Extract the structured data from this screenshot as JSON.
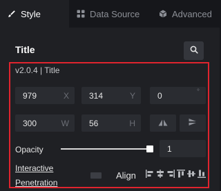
{
  "tabs": [
    {
      "label": "Style",
      "icon": "brush-icon",
      "active": true
    },
    {
      "label": "Data Source",
      "icon": "grid-icon",
      "active": false
    },
    {
      "label": "Advanced",
      "icon": "cube-icon",
      "active": false
    }
  ],
  "panel": {
    "title": "Title",
    "version": "v2.0.4 | Title",
    "position": {
      "x": "979",
      "x_label": "X",
      "y": "314",
      "y_label": "Y",
      "rotation": "0",
      "rotation_unit": "°"
    },
    "size": {
      "w": "300",
      "w_label": "W",
      "h": "56",
      "h_label": "H"
    },
    "opacity": {
      "label": "Opacity",
      "value": "1",
      "level": 1.0
    },
    "interactive_penetration": {
      "line1": "Interactive",
      "line2": "Penetration"
    },
    "align_label": "Align"
  },
  "colors": {
    "highlight_border": "#e0242e",
    "panel_bg": "#1f2024",
    "field_bg": "#2a2c31"
  }
}
